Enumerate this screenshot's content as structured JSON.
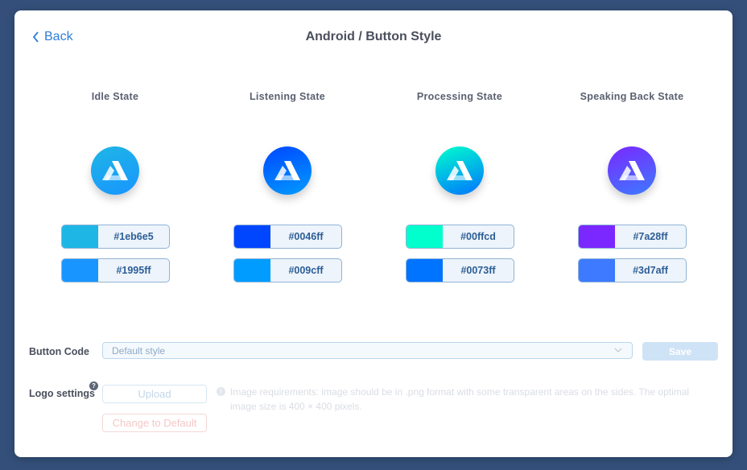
{
  "header": {
    "back_label": "Back",
    "title": "Android / Button Style"
  },
  "states": [
    {
      "label": "Idle State",
      "colors": [
        "#1eb6e5",
        "#1995ff"
      ]
    },
    {
      "label": "Listening State",
      "colors": [
        "#0046ff",
        "#009cff"
      ]
    },
    {
      "label": "Processing State",
      "colors": [
        "#00ffcd",
        "#0073ff"
      ]
    },
    {
      "label": "Speaking Back State",
      "colors": [
        "#7a28ff",
        "#3d7aff"
      ]
    }
  ],
  "button_code": {
    "label": "Button Code",
    "selected": "Default style",
    "save_label": "Save"
  },
  "logo": {
    "label": "Logo settings",
    "help": "?",
    "upload_label": "Upload",
    "default_label": "Change to Default",
    "requirements": "Image requirements: image should be in .png format with some transparent areas on the sides. The optimal image size is 400 × 400 pixels."
  },
  "icons": [
    "chevron-left-icon",
    "logo-a-icon",
    "chevron-down-icon",
    "help-icon",
    "info-icon"
  ]
}
